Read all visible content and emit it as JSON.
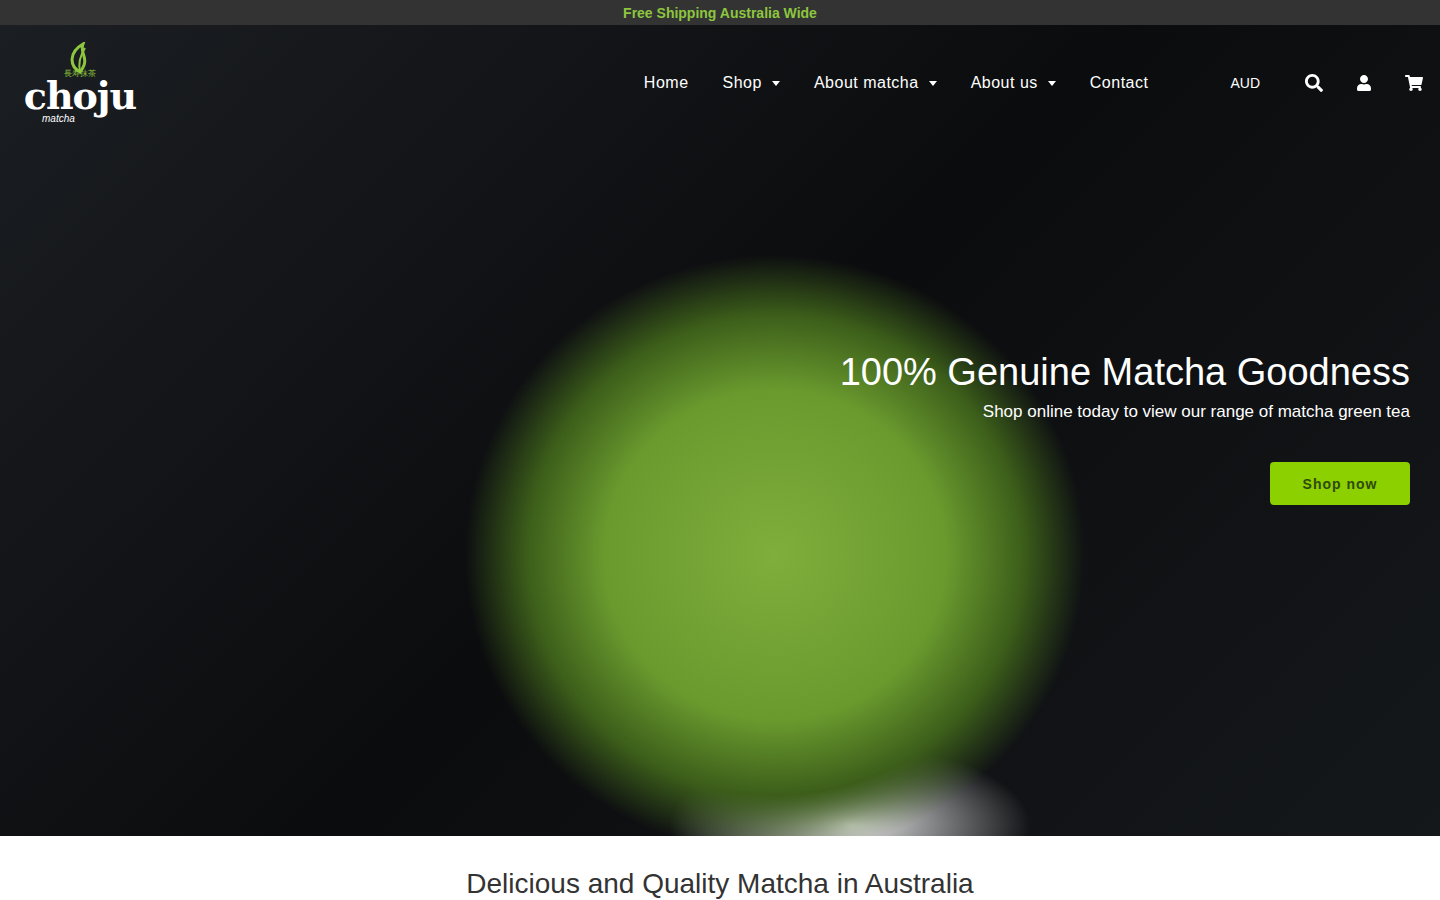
{
  "announcement": "Free Shipping Australia Wide",
  "logo": {
    "name": "choju",
    "subtitle": "matcha",
    "chinese": "長寿抹茶"
  },
  "nav": [
    {
      "label": "Home",
      "hasDropdown": false
    },
    {
      "label": "Shop",
      "hasDropdown": true
    },
    {
      "label": "About matcha",
      "hasDropdown": true
    },
    {
      "label": "About us",
      "hasDropdown": true
    },
    {
      "label": "Contact",
      "hasDropdown": false
    }
  ],
  "currency": "AUD",
  "hero": {
    "title": "100% Genuine Matcha Goodness",
    "subtitle": "Shop online today to view our range of matcha green tea",
    "button": "Shop now"
  },
  "section": {
    "title": "Delicious and Quality Matcha in Australia"
  }
}
